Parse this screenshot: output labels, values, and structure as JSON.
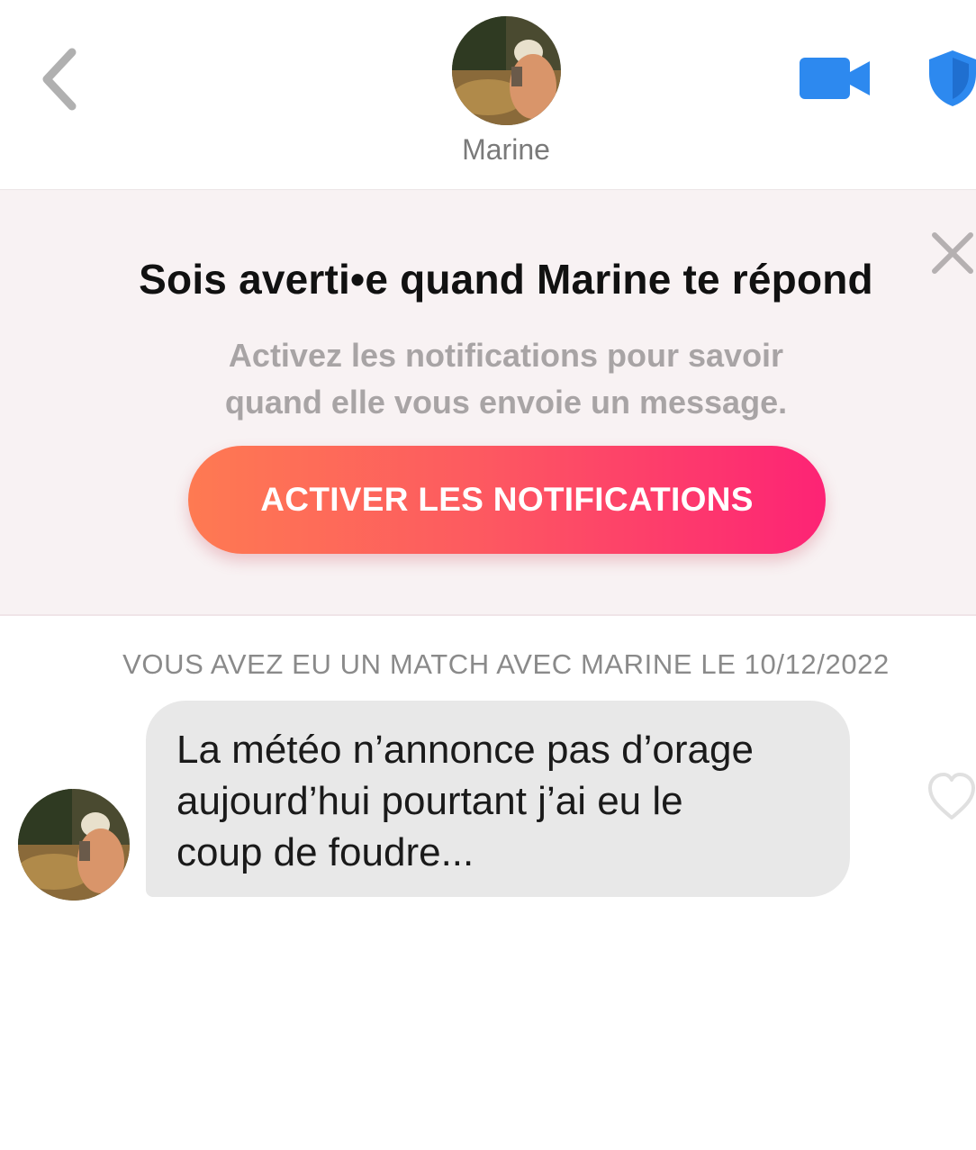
{
  "header": {
    "contact_name": "Marine"
  },
  "notification_banner": {
    "title": "Sois averti•e quand Marine te répond",
    "subtitle_line1": "Activez les notifications pour savoir",
    "subtitle_line2": "quand elle vous envoie un message.",
    "button_label": "ACTIVER LES NOTIFICATIONS"
  },
  "conversation": {
    "match_info": "VOUS AVEZ EU UN MATCH AVEC MARINE LE 10/12/2022",
    "messages": [
      {
        "line1": "La météo n’annonce pas d’orage",
        "line2": "aujourd’hui pourtant j’ai eu le",
        "line3": "coup de foudre..."
      }
    ]
  },
  "colors": {
    "accent_blue": "#2d89ef",
    "gradient_start": "#fe7a52",
    "gradient_end": "#fd2375",
    "banner_bg": "#f8f2f3",
    "bubble_bg": "#e8e8e8"
  },
  "icons": [
    "chevron-left-icon",
    "video-camera-icon",
    "shield-icon",
    "close-icon",
    "heart-icon"
  ]
}
